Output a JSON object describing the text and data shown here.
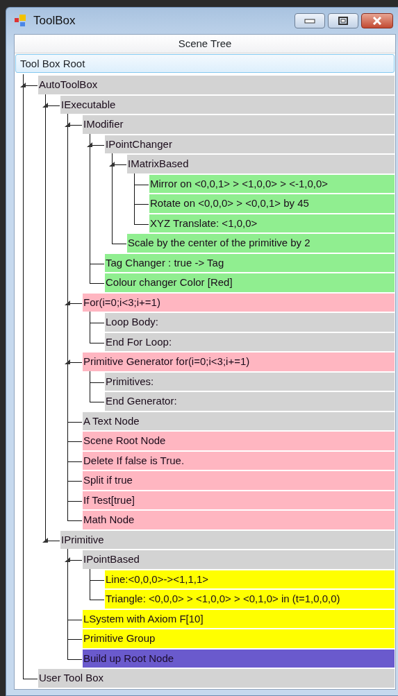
{
  "window": {
    "title": "ToolBox"
  },
  "header": "Scene Tree",
  "root": {
    "label": "Tool Box Root",
    "selected": true,
    "children": [
      {
        "label": "AutoToolBox",
        "color": "#d3d3d3",
        "selected": false,
        "expanded": true,
        "children": [
          {
            "label": "IExecutable",
            "color": "#d3d3d3",
            "selected": false,
            "expanded": true,
            "children": [
              {
                "label": "IModifier",
                "color": "#d3d3d3",
                "selected": false,
                "expanded": true,
                "children": [
                  {
                    "label": "IPointChanger",
                    "color": "#d3d3d3",
                    "selected": false,
                    "expanded": true,
                    "children": [
                      {
                        "label": "IMatrixBased",
                        "color": "#d3d3d3",
                        "selected": false,
                        "expanded": true,
                        "children": [
                          {
                            "label": "Mirror on <0,0,1> > <1,0,0> > <-1,0,0>",
                            "color": "#90ee90",
                            "selected": false
                          },
                          {
                            "label": "Rotate on <0,0,0> > <0,0,1> by 45",
                            "color": "#90ee90",
                            "selected": false
                          },
                          {
                            "label": "XYZ Translate: <1,0,0>",
                            "color": "#90ee90",
                            "selected": false
                          }
                        ]
                      },
                      {
                        "label": "Scale by the center of the primitive by 2",
                        "color": "#90ee90",
                        "selected": false
                      }
                    ]
                  },
                  {
                    "label": "Tag Changer : true -> Tag",
                    "color": "#90ee90",
                    "selected": false
                  },
                  {
                    "label": "Colour changer Color [Red]",
                    "color": "#90ee90",
                    "selected": false
                  }
                ]
              },
              {
                "label": "For(i=0;i<3;i+=1)",
                "color": "#ffb6c1",
                "selected": false,
                "expanded": true,
                "children": [
                  {
                    "label": "Loop Body:",
                    "color": "#d3d3d3",
                    "selected": false
                  },
                  {
                    "label": "End For Loop:",
                    "color": "#d3d3d3",
                    "selected": false
                  }
                ]
              },
              {
                "label": "Primitive Generator for(i=0;i<3;i+=1)",
                "color": "#ffb6c1",
                "selected": false,
                "expanded": true,
                "children": [
                  {
                    "label": "Primitives:",
                    "color": "#d3d3d3",
                    "selected": false
                  },
                  {
                    "label": "End Generator:",
                    "color": "#d3d3d3",
                    "selected": false
                  }
                ]
              },
              {
                "label": "A Text Node",
                "color": "#d3d3d3",
                "selected": false
              },
              {
                "label": "Scene Root Node",
                "color": "#ffb6c1",
                "selected": false
              },
              {
                "label": "Delete If false is True.",
                "color": "#ffb6c1",
                "selected": false
              },
              {
                "label": "Split if true",
                "color": "#ffb6c1",
                "selected": false
              },
              {
                "label": "If Test[true]",
                "color": "#ffb6c1",
                "selected": false
              },
              {
                "label": "Math Node",
                "color": "#ffb6c1",
                "selected": false
              }
            ]
          },
          {
            "label": "IPrimitive",
            "color": "#d3d3d3",
            "selected": false,
            "expanded": true,
            "children": [
              {
                "label": "IPointBased",
                "color": "#d3d3d3",
                "selected": false,
                "expanded": true,
                "children": [
                  {
                    "label": "Line:<0,0,0>-><1,1,1>",
                    "color": "#ffff00",
                    "selected": false
                  },
                  {
                    "label": "Triangle: <0,0,0> > <1,0,0> > <0,1,0> in (t=1,0,0,0)",
                    "color": "#ffff00",
                    "selected": false
                  }
                ]
              },
              {
                "label": "LSystem with Axiom F[10]",
                "color": "#ffff00",
                "selected": false
              },
              {
                "label": "Primitive Group",
                "color": "#ffff00",
                "selected": false
              },
              {
                "label": "Build up Root Node",
                "color": "#6a5acd",
                "selected": false
              }
            ]
          }
        ]
      },
      {
        "label": "User Tool Box",
        "color": "#d3d3d3",
        "selected": false
      }
    ]
  }
}
